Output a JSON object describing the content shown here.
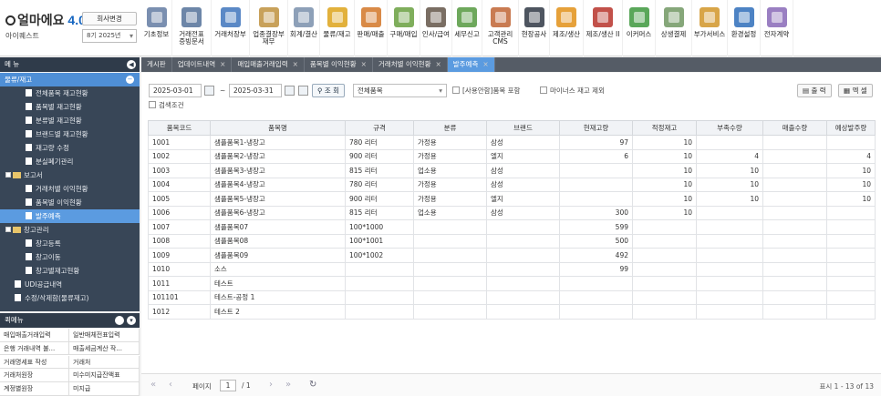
{
  "brand": {
    "logo": "얼마에요",
    "version": "4.0",
    "company": "아이퀘스트",
    "change_company": "회사변경",
    "year": "8기 2025년"
  },
  "menu": [
    {
      "label": "기초정보",
      "color": "#7a8fb0"
    },
    {
      "label": "거래전표\n증빙문서",
      "color": "#6d86a8"
    },
    {
      "label": "거래처장부",
      "color": "#5b89c6"
    },
    {
      "label": "업종결장부\n재무",
      "color": "#c8a15a"
    },
    {
      "label": "회계/결산",
      "color": "#8da0b8"
    },
    {
      "label": "물류/재고",
      "color": "#e2b13c"
    },
    {
      "label": "판매/매출",
      "color": "#d98a47"
    },
    {
      "label": "구매/매입",
      "color": "#7fae5c"
    },
    {
      "label": "인사/급여",
      "color": "#7a6e63"
    },
    {
      "label": "세무신고",
      "color": "#6ea85c"
    },
    {
      "label": "고객관리\nCMS",
      "color": "#c97b52"
    },
    {
      "label": "현장공사",
      "color": "#4e5560"
    },
    {
      "label": "제조/생산",
      "color": "#e6a13a"
    },
    {
      "label": "제조/생산 II",
      "color": "#c2514a"
    },
    {
      "label": "이커머스",
      "color": "#5aa75a"
    },
    {
      "label": "상생결제",
      "color": "#86a77a"
    },
    {
      "label": "부가서비스",
      "color": "#d8a548"
    },
    {
      "label": "환경설정",
      "color": "#4d83c4"
    },
    {
      "label": "전자계약",
      "color": "#9a7fc2"
    }
  ],
  "sidebar": {
    "title": "메 뉴",
    "section": "물류/재고",
    "items": [
      {
        "label": "전체품목 재고현황",
        "level": 2,
        "type": "doc",
        "selected": false
      },
      {
        "label": "품목별 재고현황",
        "level": 2,
        "type": "doc",
        "selected": false
      },
      {
        "label": "분류별 재고현황",
        "level": 2,
        "type": "doc",
        "selected": false
      },
      {
        "label": "브랜드별 재고현황",
        "level": 2,
        "type": "doc",
        "selected": false
      },
      {
        "label": "재고량 수정",
        "level": 2,
        "type": "doc",
        "selected": false
      },
      {
        "label": "분실폐기관리",
        "level": 2,
        "type": "doc",
        "selected": false
      },
      {
        "label": "보고서",
        "level": 0,
        "type": "folder",
        "selected": false
      },
      {
        "label": "거래처별 이익현황",
        "level": 2,
        "type": "doc",
        "selected": false
      },
      {
        "label": "품목별 이익현황",
        "level": 2,
        "type": "doc",
        "selected": false
      },
      {
        "label": "발주예측",
        "level": 2,
        "type": "doc",
        "selected": true
      },
      {
        "label": "창고관리",
        "level": 0,
        "type": "folder",
        "selected": false
      },
      {
        "label": "창고등록",
        "level": 2,
        "type": "doc",
        "selected": false
      },
      {
        "label": "창고이동",
        "level": 2,
        "type": "doc",
        "selected": false
      },
      {
        "label": "창고별재고현황",
        "level": 2,
        "type": "doc",
        "selected": false
      },
      {
        "label": "UDI공급내역",
        "level": 1,
        "type": "doc",
        "selected": false
      },
      {
        "label": "수정/삭제함(물류재고)",
        "level": 1,
        "type": "doc",
        "selected": false
      }
    ]
  },
  "favorites": {
    "title": "퀵메뉴",
    "items": [
      "매입매출거래입력",
      "일반매체전표입력",
      "은행 거래내역 불...",
      "매출세금계산 작...",
      "거래명세표 작성",
      "거래처",
      "거래처원장",
      "미수미지급잔액표",
      "계정별원장",
      "미지급"
    ]
  },
  "tabs": [
    {
      "label": "게시판",
      "closable": false,
      "active": false
    },
    {
      "label": "업데이트내역",
      "closable": true,
      "active": false
    },
    {
      "label": "매입매출거래입력",
      "closable": true,
      "active": false
    },
    {
      "label": "품목별 이익현황",
      "closable": true,
      "active": false
    },
    {
      "label": "거래처별 이익현황",
      "closable": true,
      "active": false
    },
    {
      "label": "발주예측",
      "closable": true,
      "active": true
    }
  ],
  "filters": {
    "date_from": "2025-03-01",
    "date_sep": "~",
    "date_to": "2025-03-31",
    "search_label": "조 회",
    "item_select": "전체품목",
    "used_only_label": "[사용안함]품목 포함",
    "minus_stock_label": "마이너스 재고 제외",
    "search_condition_label": "검색조건",
    "print_label": "출 력",
    "excel_label": "엑 셀"
  },
  "table": {
    "columns": [
      "품목코드",
      "품목명",
      "규격",
      "분류",
      "브랜드",
      "현재고량",
      "적정재고",
      "부족수량",
      "매출수량",
      "예상발주량"
    ],
    "rows": [
      [
        "1001",
        "샘플품목1-냉장고",
        "780 리터",
        "가정용",
        "삼성",
        "97",
        "10",
        "",
        "",
        ""
      ],
      [
        "1002",
        "샘플품목2-냉장고",
        "900 리터",
        "가정용",
        "엘지",
        "6",
        "10",
        "4",
        "",
        "4"
      ],
      [
        "1003",
        "샘플품목3-냉장고",
        "815 리터",
        "업소용",
        "삼성",
        "",
        "10",
        "10",
        "",
        "10"
      ],
      [
        "1004",
        "샘플품목4-냉장고",
        "780 리터",
        "가정용",
        "삼성",
        "",
        "10",
        "10",
        "",
        "10"
      ],
      [
        "1005",
        "샘플품목5-냉장고",
        "900 리터",
        "가정용",
        "엘지",
        "",
        "10",
        "10",
        "",
        "10"
      ],
      [
        "1006",
        "샘플품목6-냉장고",
        "815 리터",
        "업소용",
        "삼성",
        "300",
        "10",
        "",
        "",
        ""
      ],
      [
        "1007",
        "샘플품목07",
        "100*1000",
        "",
        "",
        "599",
        "",
        "",
        "",
        ""
      ],
      [
        "1008",
        "샘플품목08",
        "100*1001",
        "",
        "",
        "500",
        "",
        "",
        "",
        ""
      ],
      [
        "1009",
        "샘플품목09",
        "100*1002",
        "",
        "",
        "492",
        "",
        "",
        "",
        ""
      ],
      [
        "1010",
        "소스",
        "",
        "",
        "",
        "99",
        "",
        "",
        "",
        ""
      ],
      [
        "1011",
        "테스트",
        "",
        "",
        "",
        "",
        "",
        "",
        "",
        ""
      ],
      [
        "101101",
        "테스트-공정 1",
        "",
        "",
        "",
        "",
        "",
        "",
        "",
        ""
      ],
      [
        "1012",
        "테스트 2",
        "",
        "",
        "",
        "",
        "",
        "",
        "",
        ""
      ]
    ]
  },
  "pager": {
    "page_label": "페이지",
    "page": "1",
    "total_pages": "/ 1",
    "info": "표시 1 - 13 of 13"
  }
}
